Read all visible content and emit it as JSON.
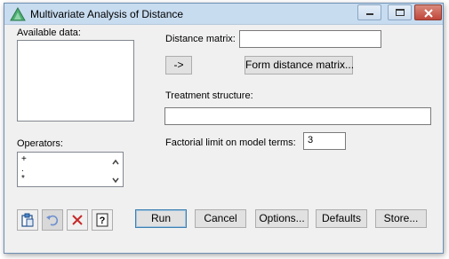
{
  "window": {
    "title": "Multivariate Analysis of Distance"
  },
  "available_data": {
    "label": "Available data:"
  },
  "distance": {
    "label": "Distance matrix:",
    "value": ""
  },
  "arrow_button": {
    "label": "->"
  },
  "form_button": {
    "label": "Form distance matrix..."
  },
  "treatment": {
    "label": "Treatment structure:",
    "value": ""
  },
  "operators": {
    "label": "Operators:",
    "items": [
      "+",
      ".",
      "*"
    ]
  },
  "factorial": {
    "label": "Factorial limit on model terms:",
    "value": "3"
  },
  "buttons": {
    "run": "Run",
    "cancel": "Cancel",
    "options": "Options...",
    "defaults": "Defaults",
    "store": "Store..."
  },
  "icons": {
    "app": "triangle-app-icon",
    "toolbar": [
      "clipboard-icon",
      "undo-icon",
      "clear-icon",
      "help-icon"
    ]
  },
  "colors": {
    "titlebar": "#c8dcf0",
    "close": "#c0463a",
    "default_border": "#3c7fb1"
  }
}
